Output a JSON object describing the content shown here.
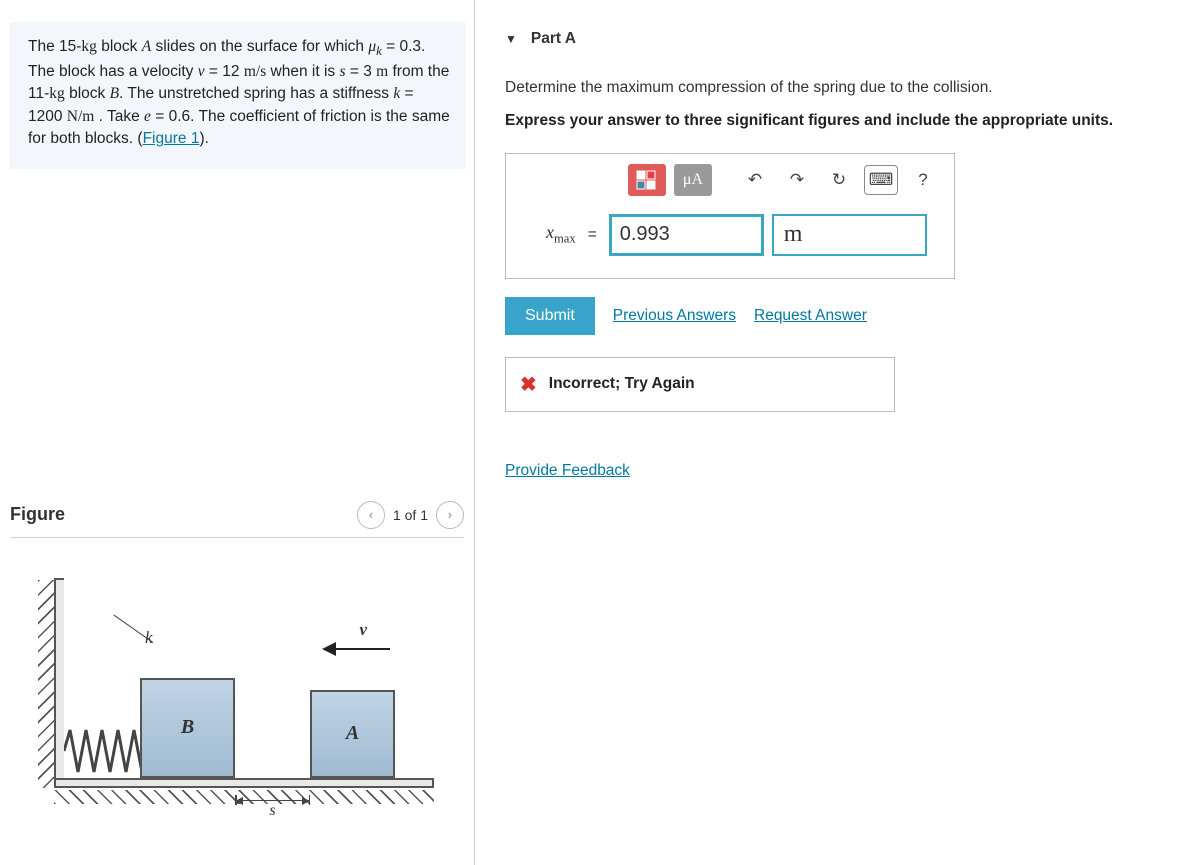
{
  "problem": {
    "text_parts": {
      "p1a": "The 15-",
      "kg1": "kg",
      "p1b": " block ",
      "A": "A",
      "p1c": " slides on the surface for which ",
      "mu": "μ",
      "ksub": "k",
      "p1d": " = 0.3. The block has a velocity ",
      "v": "v",
      "p1e": " = 12 ",
      "ms": "m/s",
      "p1f": " when it is ",
      "s": "s",
      "p1g": " = 3 ",
      "m": "m",
      "p1h": " from the 11-",
      "kg2": "kg",
      "p1i": " block ",
      "B": "B",
      "p1j": ". The unstretched spring has a stiffness ",
      "k": "k",
      "p1k": " = 1200 ",
      "Nm": "N/m",
      "p1l": " . Take ",
      "e": "e",
      "p1m": " = 0.6. The coefficient of friction is the same for both blocks. (",
      "fig": "Figure 1",
      "p1n": ")."
    }
  },
  "figure": {
    "title": "Figure",
    "counter": "1 of 1",
    "labels": {
      "k": "k",
      "v": "v",
      "A": "A",
      "B": "B",
      "s": "s"
    }
  },
  "partA": {
    "header": "Part A",
    "prompt": "Determine the maximum compression of the spring due to the collision.",
    "hint": "Express your answer to three significant figures and include the appropriate units.",
    "toolbar": {
      "templates": "▦",
      "mu_btn": "μA",
      "undo": "↶",
      "redo": "↷",
      "reset": "↻",
      "keyboard": "⌨",
      "help": "?"
    },
    "variable_symbol": "x",
    "variable_sub": "max",
    "equals": " = ",
    "value": "0.993",
    "unit": "m",
    "submit": "Submit",
    "previous": "Previous Answers",
    "request": "Request Answer",
    "feedback_icon": "✖",
    "feedback_text": "Incorrect; Try Again"
  },
  "provide_feedback": "Provide Feedback"
}
